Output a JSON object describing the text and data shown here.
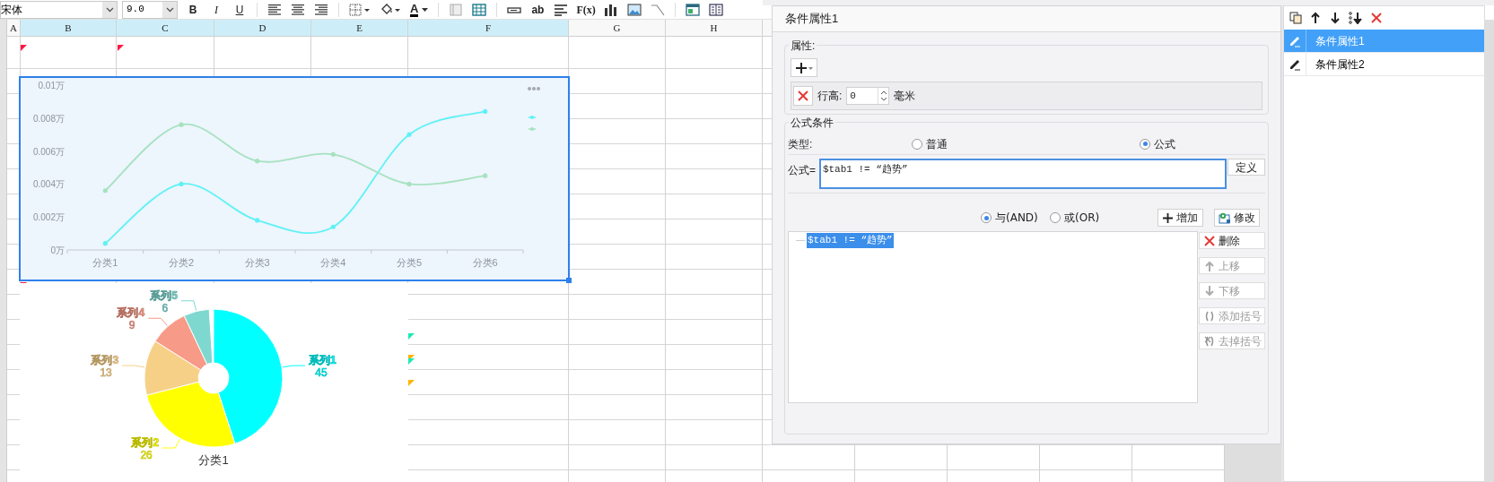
{
  "toolbar": {
    "font": "宋体",
    "font_size": "9.0",
    "text_buttons": [
      "B",
      "I",
      "U",
      "A",
      "ab",
      "F(x)"
    ]
  },
  "sheet": {
    "columns": [
      {
        "label": "A",
        "selected": false
      },
      {
        "label": "B",
        "selected": true
      },
      {
        "label": "C",
        "selected": true
      },
      {
        "label": "D",
        "selected": true
      },
      {
        "label": "E",
        "selected": true
      },
      {
        "label": "F",
        "selected": true
      },
      {
        "label": "G",
        "selected": false
      },
      {
        "label": "H",
        "selected": false
      }
    ]
  },
  "line_chart": {
    "chart_data": {
      "type": "line",
      "categories": [
        "分类1",
        "分类2",
        "分类3",
        "分类4",
        "分类5",
        "分类6"
      ],
      "series": [
        {
          "color": "#5ef2f6",
          "values": [
            0.0004,
            0.004,
            0.0018,
            0.0014,
            0.007,
            0.0084
          ]
        },
        {
          "color": "#a6e2bf",
          "values": [
            0.0036,
            0.0076,
            0.0054,
            0.0058,
            0.004,
            0.0045
          ]
        }
      ],
      "ylim": [
        0,
        0.01
      ],
      "yticks": [
        {
          "value": 0,
          "label": "0万"
        },
        {
          "value": 0.002,
          "label": "0.002万"
        },
        {
          "value": 0.004,
          "label": "0.004万"
        },
        {
          "value": 0.006,
          "label": "0.006万"
        },
        {
          "value": 0.008,
          "label": "0.008万"
        },
        {
          "value": 0.01,
          "label": "0.01万"
        }
      ]
    }
  },
  "pie_chart": {
    "category_label": "分类1",
    "slices": [
      {
        "color": "#00ffff"
      },
      {
        "color": "#ffff00"
      },
      {
        "color": "#f7d088"
      },
      {
        "color": "#f89a88"
      },
      {
        "color": "#7fd8d0"
      }
    ],
    "chart_data": {
      "type": "donut",
      "categories": [
        "系列1",
        "系列2",
        "系列3",
        "系列4",
        "系列5"
      ],
      "values": [
        45,
        26,
        13,
        9,
        6
      ],
      "data_labels": true
    }
  },
  "dialog": {
    "title": "条件属性1",
    "attributes": {
      "legend": "属性:",
      "row_label": "行高:",
      "row_value": "0",
      "unit": "毫米"
    },
    "formula_condition": {
      "legend": "公式条件",
      "type_label": "类型:",
      "types": [
        {
          "label": "普通",
          "selected": false
        },
        {
          "label": "公式",
          "selected": true
        }
      ],
      "formula_label": "公式=",
      "formula_value": "$tab1 != “趋势”",
      "define_button": "定义",
      "joins": [
        {
          "label": "与(AND)",
          "selected": true
        },
        {
          "label": "或(OR)",
          "selected": false
        }
      ],
      "add_button": "增加",
      "modify_button": "修改",
      "conditions": [
        {
          "text": "$tab1 != “趋势”",
          "selected": true
        }
      ],
      "side_buttons": [
        {
          "kind": "delete",
          "label": "删除",
          "disabled": false
        },
        {
          "kind": "up",
          "label": "上移",
          "disabled": true
        },
        {
          "kind": "down",
          "label": "下移",
          "disabled": true
        },
        {
          "kind": "add-paren",
          "label": "添加括号",
          "disabled": true
        },
        {
          "kind": "remove-paren",
          "label": "去掉括号",
          "disabled": true
        }
      ]
    }
  },
  "condition_list": {
    "items": [
      {
        "label": "条件属性1",
        "selected": true
      },
      {
        "label": "条件属性2",
        "selected": false
      }
    ]
  }
}
